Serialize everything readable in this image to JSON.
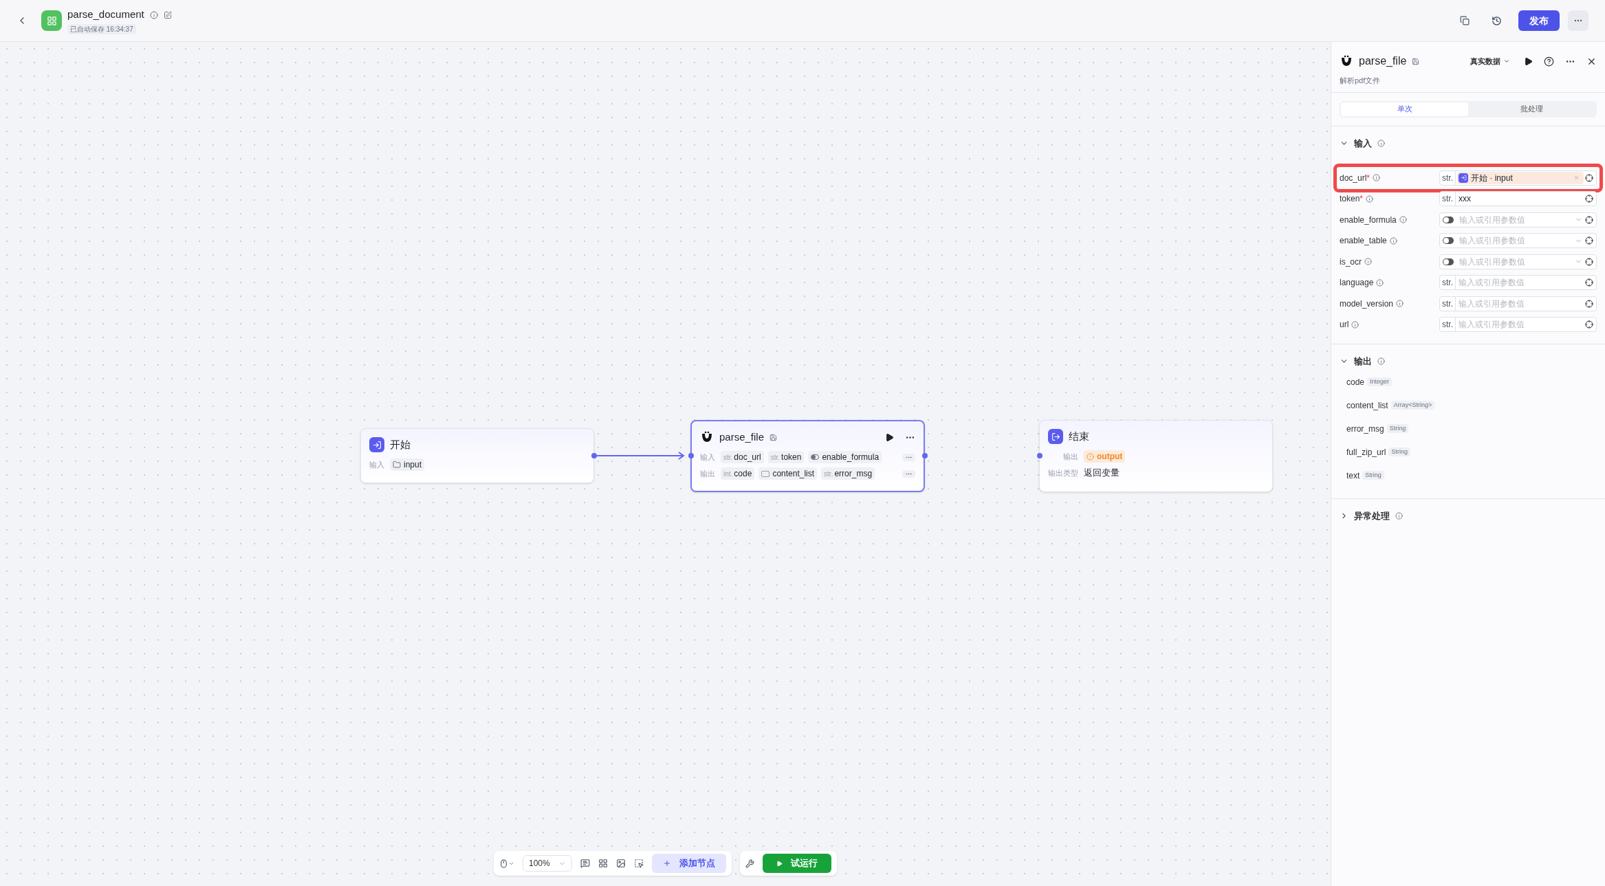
{
  "header": {
    "title": "parse_document",
    "saved": "已自动保存 16:34:37",
    "publish": "发布"
  },
  "canvas": {
    "nodes": [
      {
        "kind": "start",
        "title": "开始",
        "selected": false,
        "rows": [
          {
            "label": "输入",
            "items": [
              {
                "kind": "folder",
                "name": "input"
              }
            ]
          }
        ]
      },
      {
        "kind": "plugin",
        "title": "parse_file",
        "selected": true,
        "rows": [
          {
            "label": "输入",
            "items": [
              {
                "kind": "typed",
                "type": "str.",
                "name": "doc_url"
              },
              {
                "kind": "typed",
                "type": "str.",
                "name": "token"
              },
              {
                "kind": "toggle",
                "name": "enable_formula"
              }
            ]
          },
          {
            "label": "输出",
            "items": [
              {
                "kind": "typed",
                "type": "int.",
                "name": "code"
              },
              {
                "kind": "array",
                "name": "content_list"
              },
              {
                "kind": "typed",
                "type": "str.",
                "name": "error_msg"
              }
            ]
          }
        ]
      },
      {
        "kind": "end",
        "title": "结束",
        "selected": false,
        "rows": [
          {
            "label": "输出",
            "items": [
              {
                "kind": "warning",
                "name": "output"
              }
            ]
          },
          {
            "label": "输出类型",
            "items": [
              {
                "kind": "plain",
                "name": "返回变量"
              }
            ]
          }
        ]
      }
    ]
  },
  "toolbar": {
    "zoom": "100%",
    "add_node": "添加节点",
    "run": "试运行"
  },
  "panel": {
    "required_mark": "*",
    "title": "parse_file",
    "description": "解析pdf文件",
    "data_mode": "真实数据",
    "tabs": [
      {
        "label": "单次",
        "selected": true
      },
      {
        "label": "批处理",
        "selected": false
      }
    ],
    "inputs_title": "输入",
    "expanded_inputs": true,
    "params": [
      {
        "kind": "str",
        "name": "doc_url",
        "required": true,
        "highlighted": true,
        "type": "str.",
        "reference": {
          "node": "开始",
          "separator": "·",
          "var": "input"
        }
      },
      {
        "kind": "str",
        "name": "token",
        "required": true,
        "highlighted": false,
        "type": "str.",
        "value": "xxx"
      },
      {
        "kind": "toggle",
        "name": "enable_formula",
        "required": false,
        "highlighted": false,
        "on": false,
        "placeholder": "输入或引用参数值"
      },
      {
        "kind": "toggle",
        "name": "enable_table",
        "required": false,
        "highlighted": false,
        "on": false,
        "placeholder": "输入或引用参数值"
      },
      {
        "kind": "toggle",
        "name": "is_ocr",
        "required": false,
        "highlighted": false,
        "on": false,
        "placeholder": "输入或引用参数值"
      },
      {
        "kind": "str",
        "name": "language",
        "required": false,
        "highlighted": false,
        "type": "str.",
        "placeholder": "输入或引用参数值"
      },
      {
        "kind": "str",
        "name": "model_version",
        "required": false,
        "highlighted": false,
        "type": "str.",
        "placeholder": "输入或引用参数值"
      },
      {
        "kind": "str",
        "name": "url",
        "required": false,
        "highlighted": false,
        "type": "str.",
        "placeholder": "输入或引用参数值"
      }
    ],
    "outputs_title": "输出",
    "expanded_outputs": true,
    "outputs": [
      {
        "name": "code",
        "type": "Integer"
      },
      {
        "name": "content_list",
        "type": "Array<String>"
      },
      {
        "name": "error_msg",
        "type": "String"
      },
      {
        "name": "full_zip_url",
        "type": "String"
      },
      {
        "name": "text",
        "type": "String"
      }
    ],
    "exception_title": "异常处理",
    "expanded_exception": false
  }
}
